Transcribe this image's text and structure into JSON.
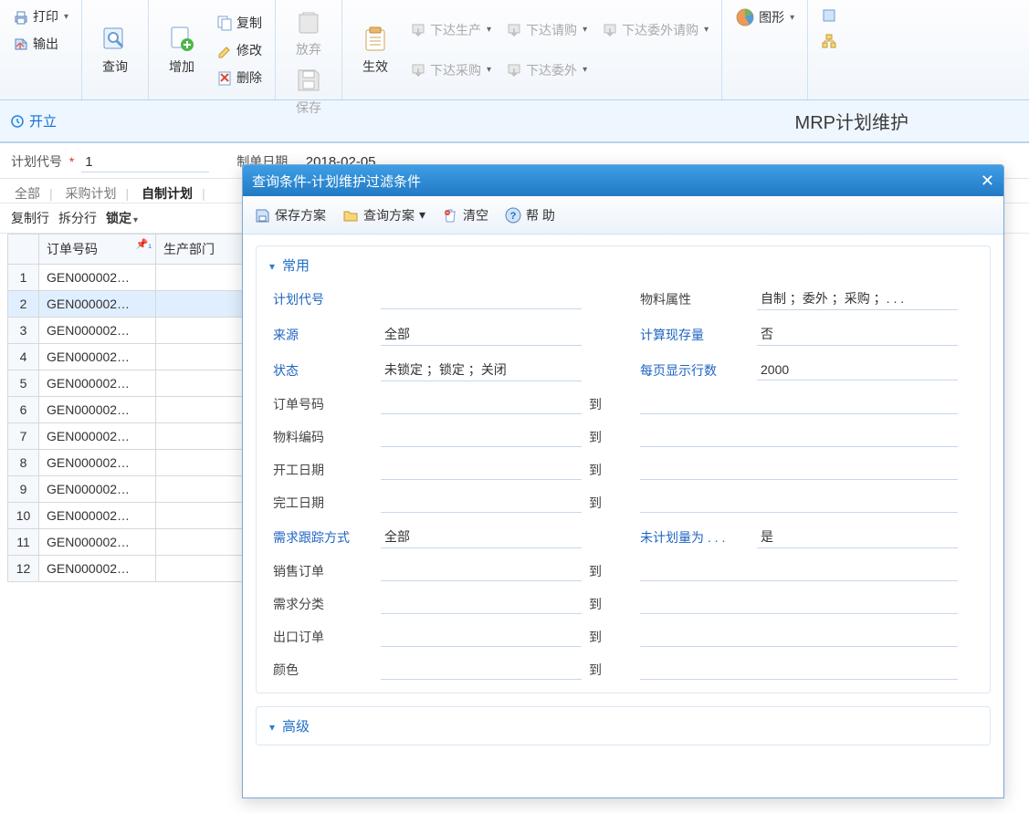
{
  "ribbon": {
    "print": "打印",
    "output": "输出",
    "query": "查询",
    "add": "增加",
    "copy": "复制",
    "modify": "修改",
    "delete": "删除",
    "abandon": "放弃",
    "save": "保存",
    "effect": "生效",
    "issue_prod": "下达生产",
    "issue_req": "下达请购",
    "issue_outsrc_req": "下达委外请购",
    "issue_purchase": "下达采购",
    "issue_outsrc": "下达委外",
    "graphic": "图形"
  },
  "titlebar": {
    "kaili": "开立",
    "page_title": "MRP计划维护"
  },
  "headform": {
    "plan_code_label": "计划代号",
    "plan_code_value": "1",
    "make_date_label": "制单日期",
    "make_date_value": "2018-02-05"
  },
  "tabs": {
    "all": "全部",
    "purchase": "采购计划",
    "self": "自制计划"
  },
  "gridbar": {
    "copy_row": "复制行",
    "split_row": "拆分行",
    "lock": "锁定"
  },
  "grid": {
    "cols": {
      "order_no": "订单号码",
      "dept": "生产部门"
    },
    "rows": [
      {
        "n": "1",
        "order": "GEN000002…"
      },
      {
        "n": "2",
        "order": "GEN000002…"
      },
      {
        "n": "3",
        "order": "GEN000002…"
      },
      {
        "n": "4",
        "order": "GEN000002…"
      },
      {
        "n": "5",
        "order": "GEN000002…"
      },
      {
        "n": "6",
        "order": "GEN000002…"
      },
      {
        "n": "7",
        "order": "GEN000002…"
      },
      {
        "n": "8",
        "order": "GEN000002…"
      },
      {
        "n": "9",
        "order": "GEN000002…"
      },
      {
        "n": "10",
        "order": "GEN000002…"
      },
      {
        "n": "11",
        "order": "GEN000002…"
      },
      {
        "n": "12",
        "order": "GEN000002…"
      }
    ]
  },
  "dialog": {
    "title": "查询条件-计划维护过滤条件",
    "toolbar": {
      "save_scheme": "保存方案",
      "query_scheme": "查询方案",
      "clear": "清空",
      "help": "帮 助"
    },
    "common_hd": "常用",
    "advanced_hd": "高级",
    "to": "到",
    "fields": {
      "plan_code": {
        "label": "计划代号",
        "value": ""
      },
      "material_attr": {
        "label": "物料属性",
        "value": "自制 ；委外 ；采购 ；. . ."
      },
      "source": {
        "label": "来源",
        "value": "全部"
      },
      "calc_stock": {
        "label": "计算现存量",
        "value": "否"
      },
      "status": {
        "label": "状态",
        "value": "未锁定 ；锁定 ；关闭"
      },
      "page_rows": {
        "label": "每页显示行数",
        "value": "2000"
      },
      "order_no": {
        "label": "订单号码"
      },
      "material_code": {
        "label": "物料编码"
      },
      "start_date": {
        "label": "开工日期"
      },
      "end_date": {
        "label": "完工日期"
      },
      "demand_track": {
        "label": "需求跟踪方式",
        "value": "全部"
      },
      "unplanned_qty": {
        "label": "未计划量为 . . .",
        "value": "是"
      },
      "sales_order": {
        "label": "销售订单"
      },
      "demand_class": {
        "label": "需求分类"
      },
      "export_order": {
        "label": "出口订单"
      },
      "color": {
        "label": "颜色"
      }
    }
  }
}
